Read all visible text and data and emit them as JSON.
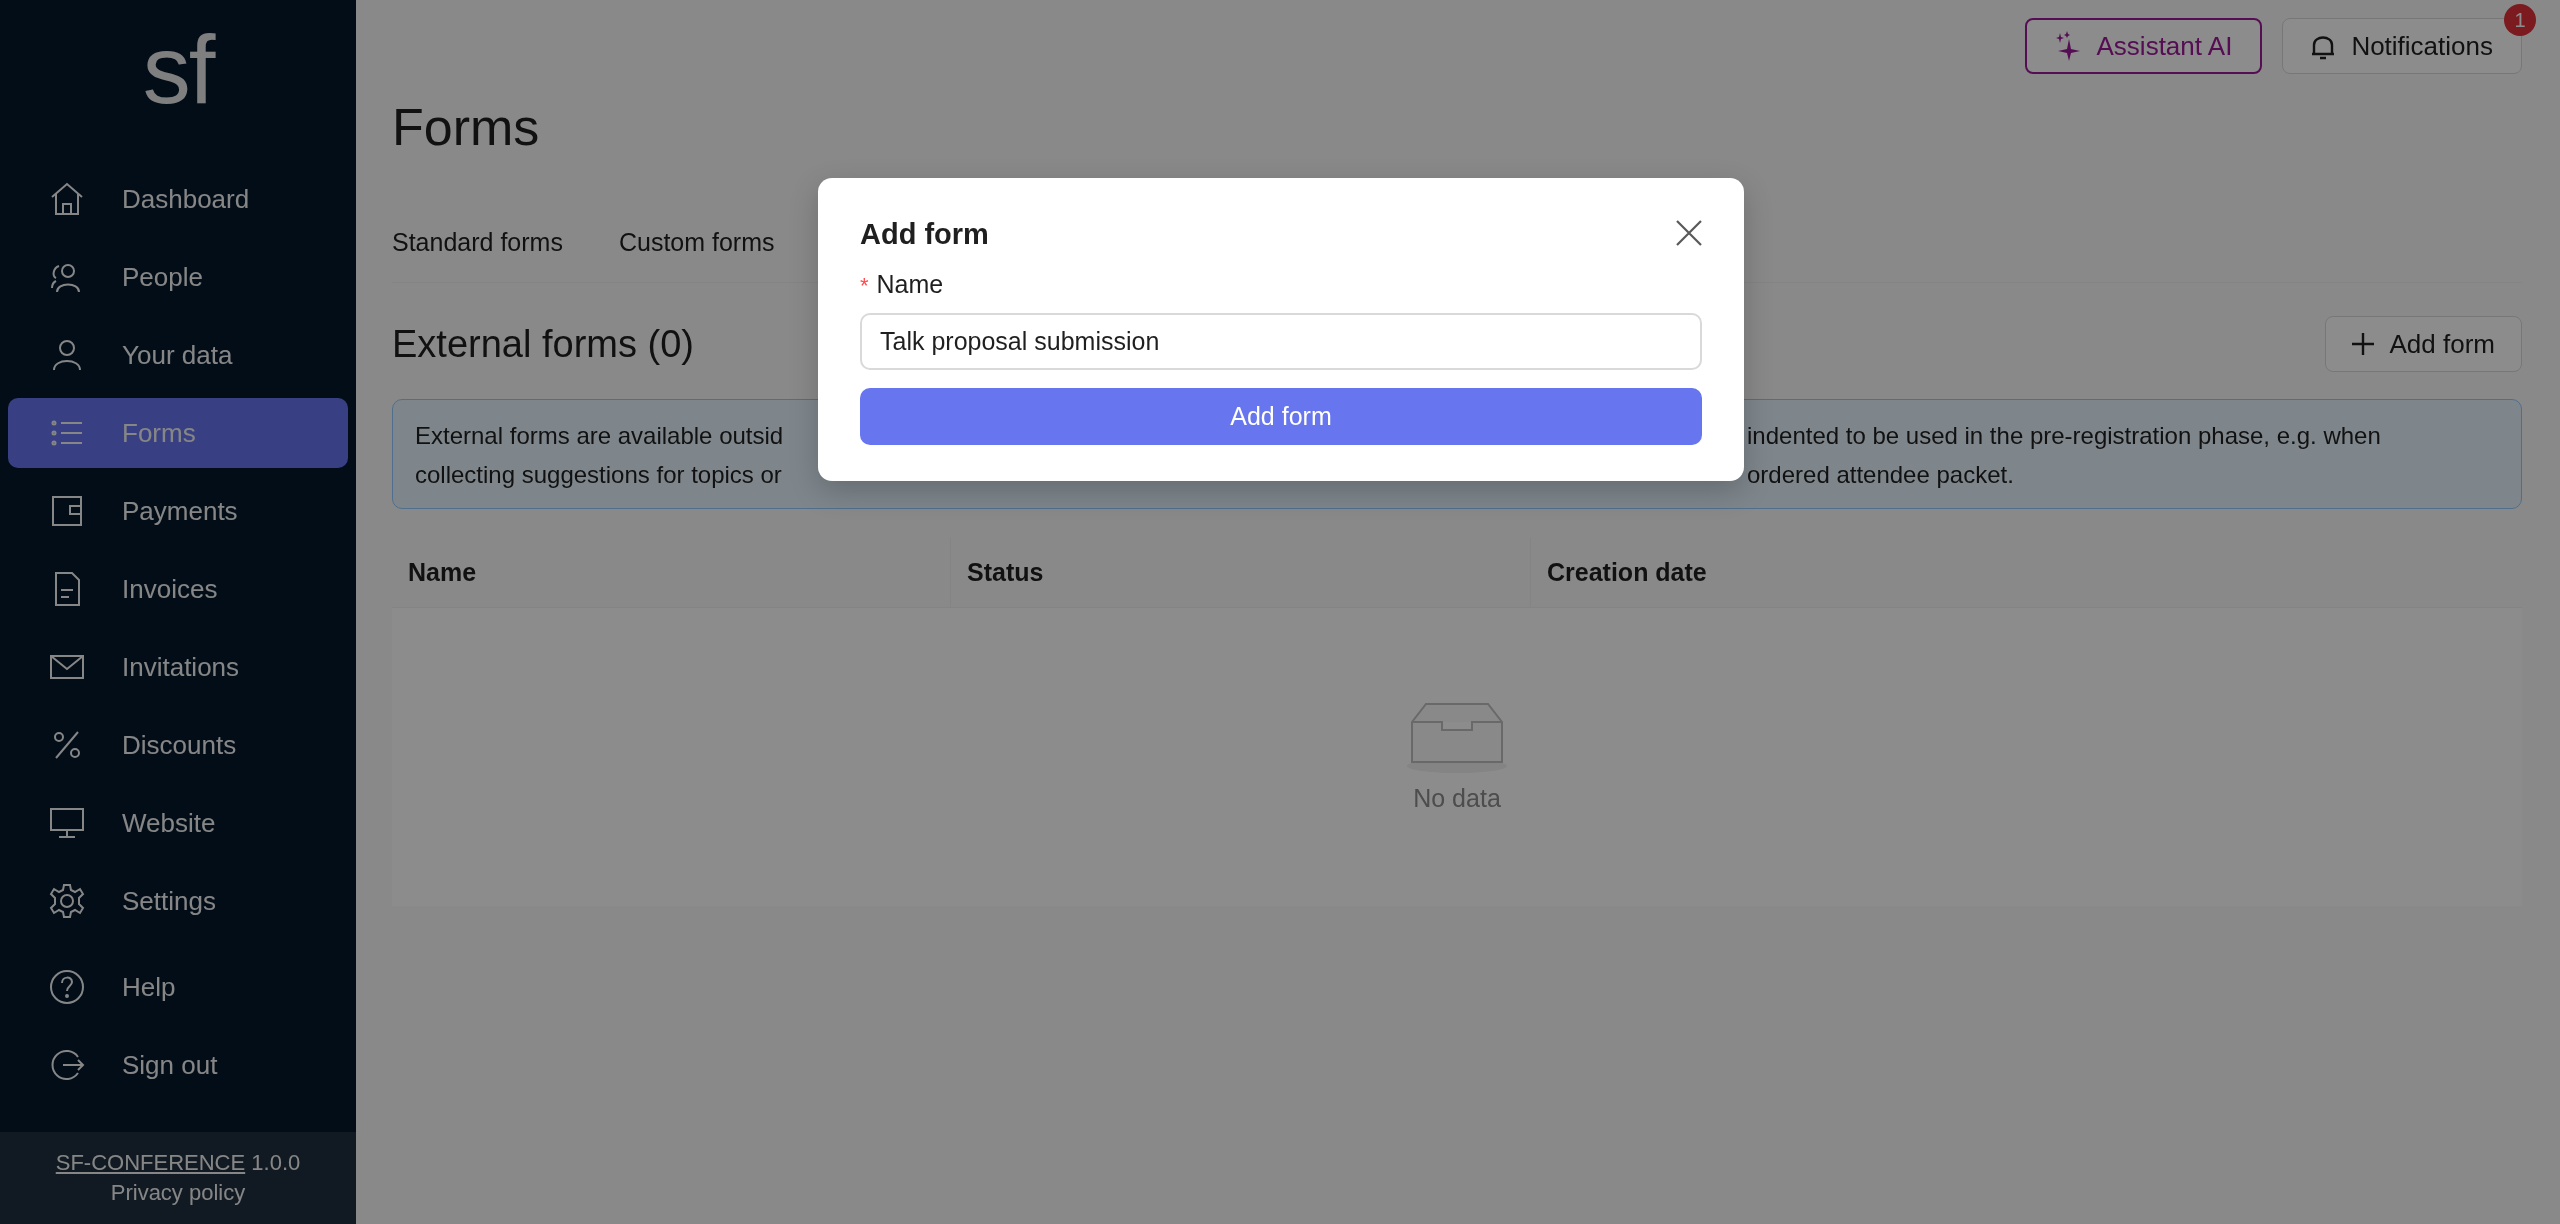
{
  "sidebar": {
    "logo": "sf",
    "items": [
      {
        "label": "Dashboard",
        "selected": false
      },
      {
        "label": "People",
        "selected": false
      },
      {
        "label": "Your data",
        "selected": false
      },
      {
        "label": "Forms",
        "selected": true
      },
      {
        "label": "Payments",
        "selected": false
      },
      {
        "label": "Invoices",
        "selected": false
      },
      {
        "label": "Invitations",
        "selected": false
      },
      {
        "label": "Discounts",
        "selected": false
      },
      {
        "label": "Website",
        "selected": false
      },
      {
        "label": "Settings",
        "selected": false
      },
      {
        "label": "Help",
        "selected": false
      },
      {
        "label": "Sign out",
        "selected": false
      }
    ],
    "footer": {
      "link": "SF-CONFERENCE",
      "version": "1.0.0",
      "privacy": "Privacy policy"
    }
  },
  "header": {
    "assistant_button": "Assistant AI",
    "notifications_button": "Notifications",
    "notifications_badge": "1"
  },
  "page_title": "Forms",
  "tabs": [
    {
      "label": "Standard forms",
      "selected": false
    },
    {
      "label": "Custom forms",
      "selected": false
    }
  ],
  "section": {
    "title": "External forms (0)",
    "add_button": "Add form"
  },
  "info": {
    "line_1_start": "External forms are available outsid",
    "line_1_end": "indented to be used in the pre-registration phase, e.g. when",
    "line_2_start": "collecting suggestions for topics or",
    "line_2_end": "ordered attendee packet."
  },
  "table": {
    "columns": [
      "Name",
      "Status",
      "Creation date"
    ],
    "empty_text": "No data"
  },
  "modal": {
    "title": "Add form",
    "required_mark": "*",
    "field_label": "Name",
    "value": "Talk proposal submission",
    "submit_button": "Add form"
  }
}
